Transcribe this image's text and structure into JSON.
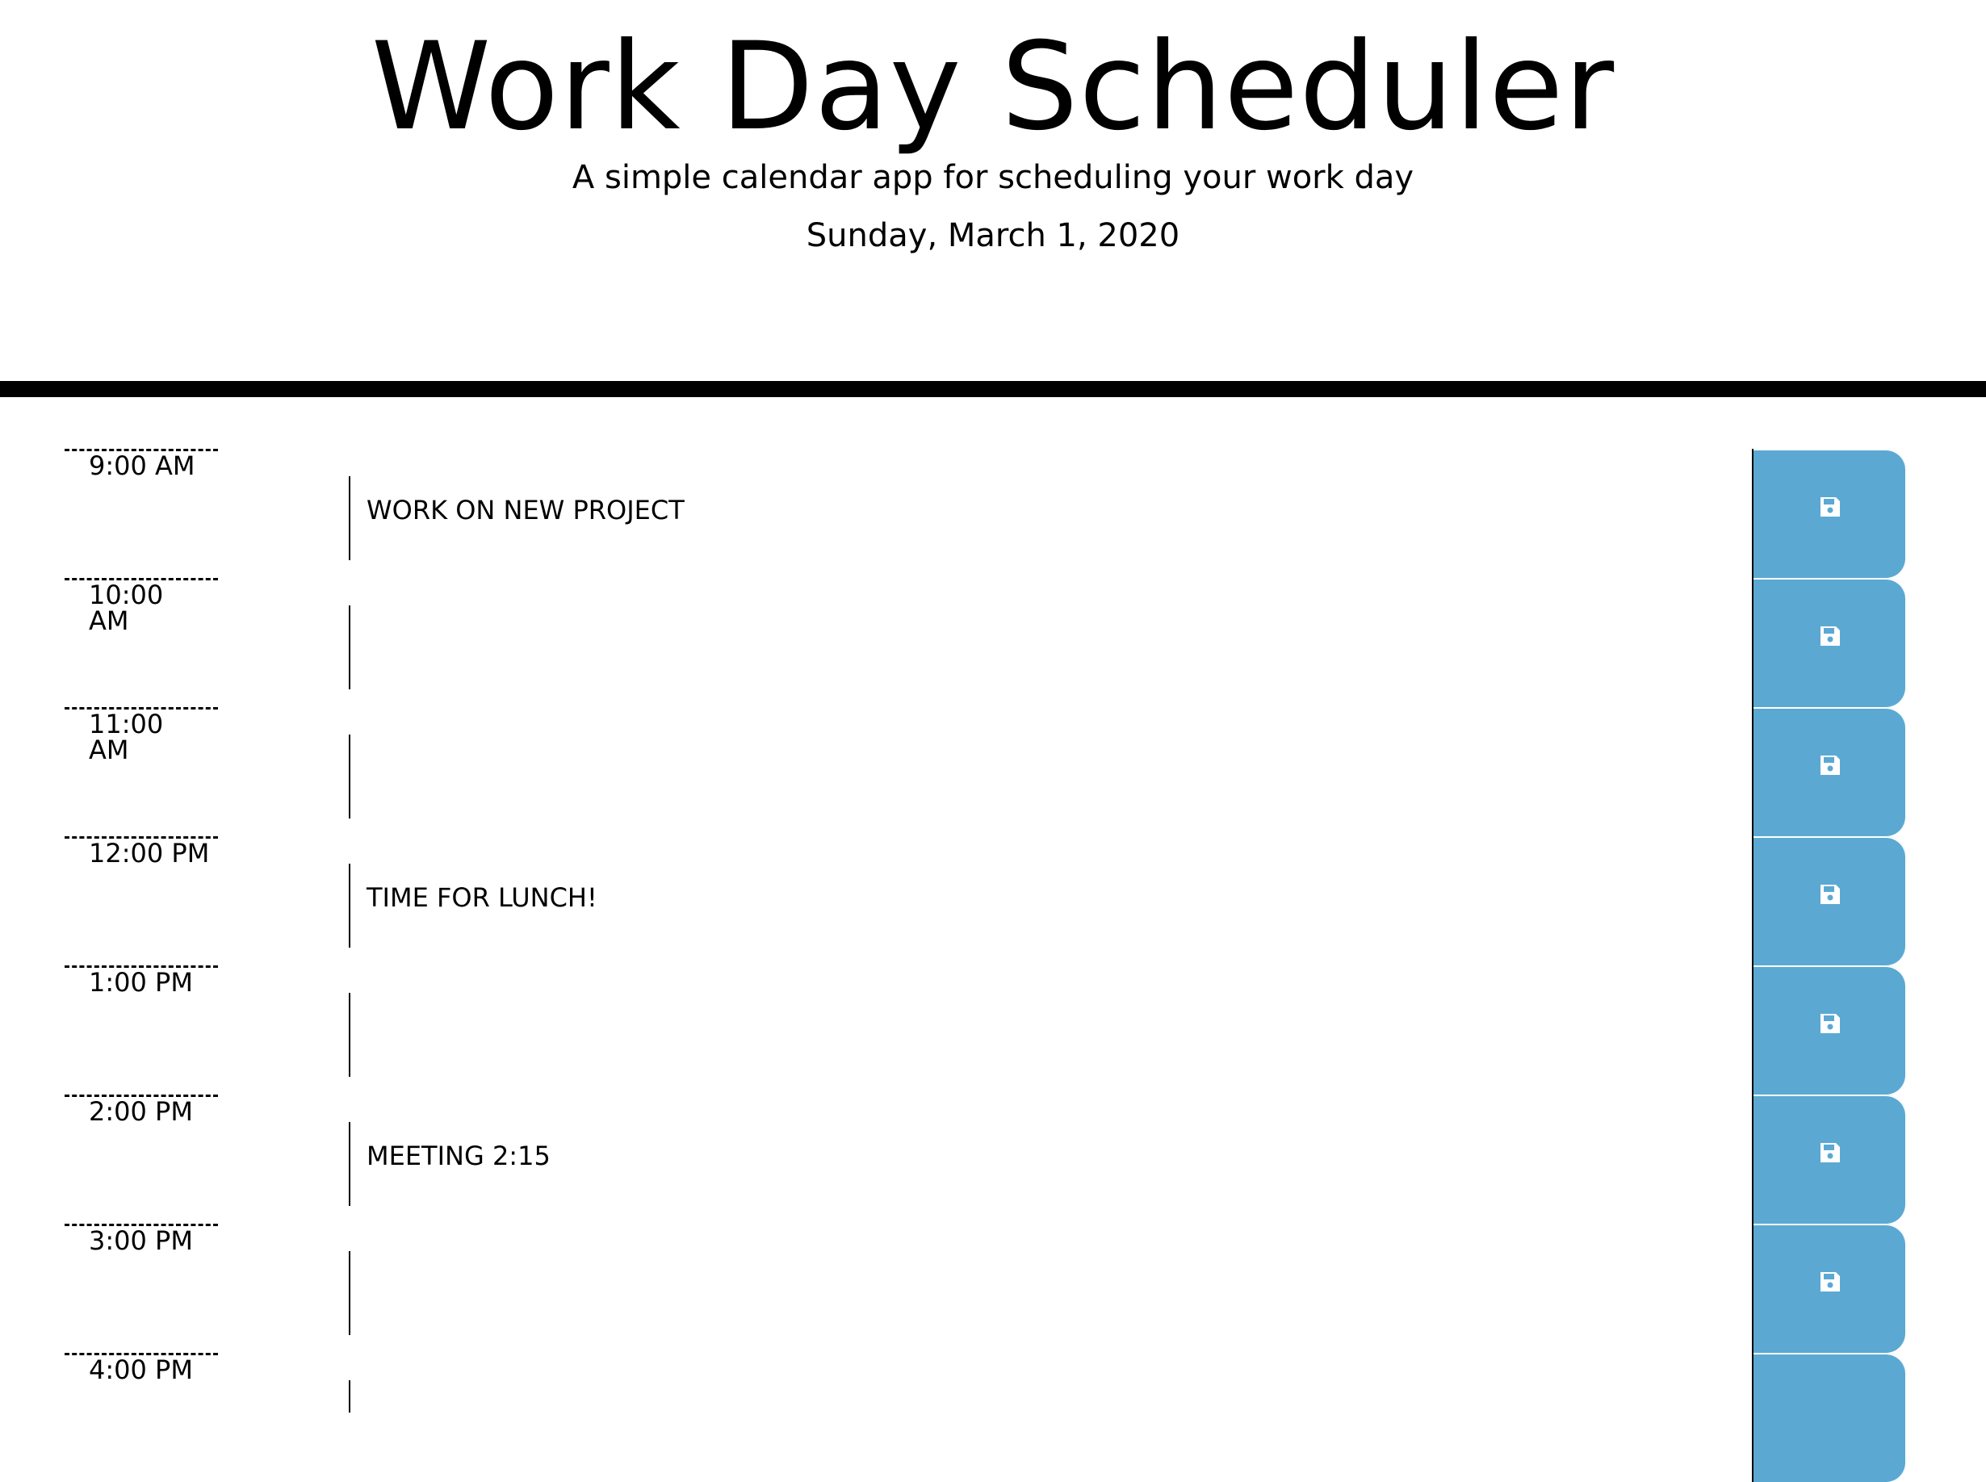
{
  "header": {
    "title": "Work Day Scheduler",
    "subtitle": "A simple calendar app for scheduling your work day",
    "current_day": "Sunday, March 1, 2020"
  },
  "timeblocks": [
    {
      "hour": "9:00 AM",
      "description": "WORK ON NEW PROJECT"
    },
    {
      "hour": "10:00 AM",
      "description": ""
    },
    {
      "hour": "11:00 AM",
      "description": ""
    },
    {
      "hour": "12:00 PM",
      "description": "TIME FOR LUNCH!"
    },
    {
      "hour": "1:00 PM",
      "description": ""
    },
    {
      "hour": "2:00 PM",
      "description": "MEETING 2:15"
    },
    {
      "hour": "3:00 PM",
      "description": ""
    },
    {
      "hour": "4:00 PM",
      "description": ""
    }
  ],
  "save_button": {
    "icon": "floppy-disk-save-icon",
    "color": "#5ba9d3"
  }
}
